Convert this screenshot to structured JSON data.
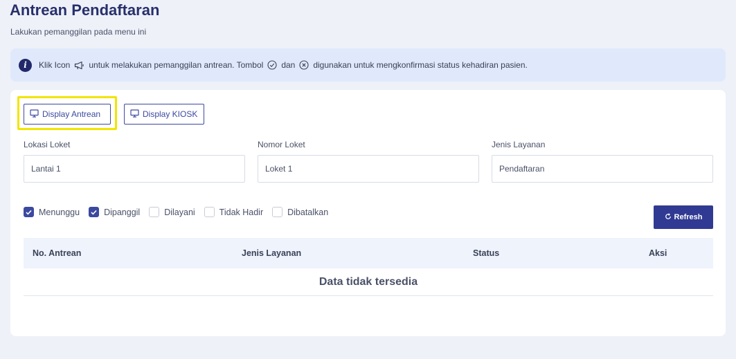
{
  "header": {
    "title": "Antrean Pendaftaran",
    "subtitle": "Lakukan pemanggilan pada menu ini"
  },
  "info": {
    "text_1": "Klik Icon",
    "text_2": "untuk melakukan pemanggilan antrean. Tombol",
    "text_3": "dan",
    "text_4": "digunakan untuk mengkonfirmasi status kehadiran pasien.",
    "icons": [
      "info-icon",
      "megaphone-icon",
      "check-circle-icon",
      "x-circle-icon"
    ]
  },
  "buttons": {
    "display_antrean": "Display Antrean",
    "display_kiosk": "Display KIOSK",
    "refresh": "Refresh"
  },
  "fields": {
    "lokasi_loket": {
      "label": "Lokasi Loket",
      "value": "Lantai 1"
    },
    "nomor_loket": {
      "label": "Nomor Loket",
      "value": "Loket 1"
    },
    "jenis_layanan": {
      "label": "Jenis Layanan",
      "value": "Pendaftaran"
    }
  },
  "filters": [
    {
      "label": "Menunggu",
      "checked": true
    },
    {
      "label": "Dipanggil",
      "checked": true
    },
    {
      "label": "Dilayani",
      "checked": false
    },
    {
      "label": "Tidak Hadir",
      "checked": false
    },
    {
      "label": "Dibatalkan",
      "checked": false
    }
  ],
  "table": {
    "columns": [
      "No. Antrean",
      "Jenis Layanan",
      "Status",
      "Aksi"
    ],
    "empty_message": "Data tidak tersedia"
  },
  "colors": {
    "primary": "#303a92",
    "title": "#27306b",
    "highlight": "#f2e500",
    "info_bg": "#dfe9fb"
  }
}
